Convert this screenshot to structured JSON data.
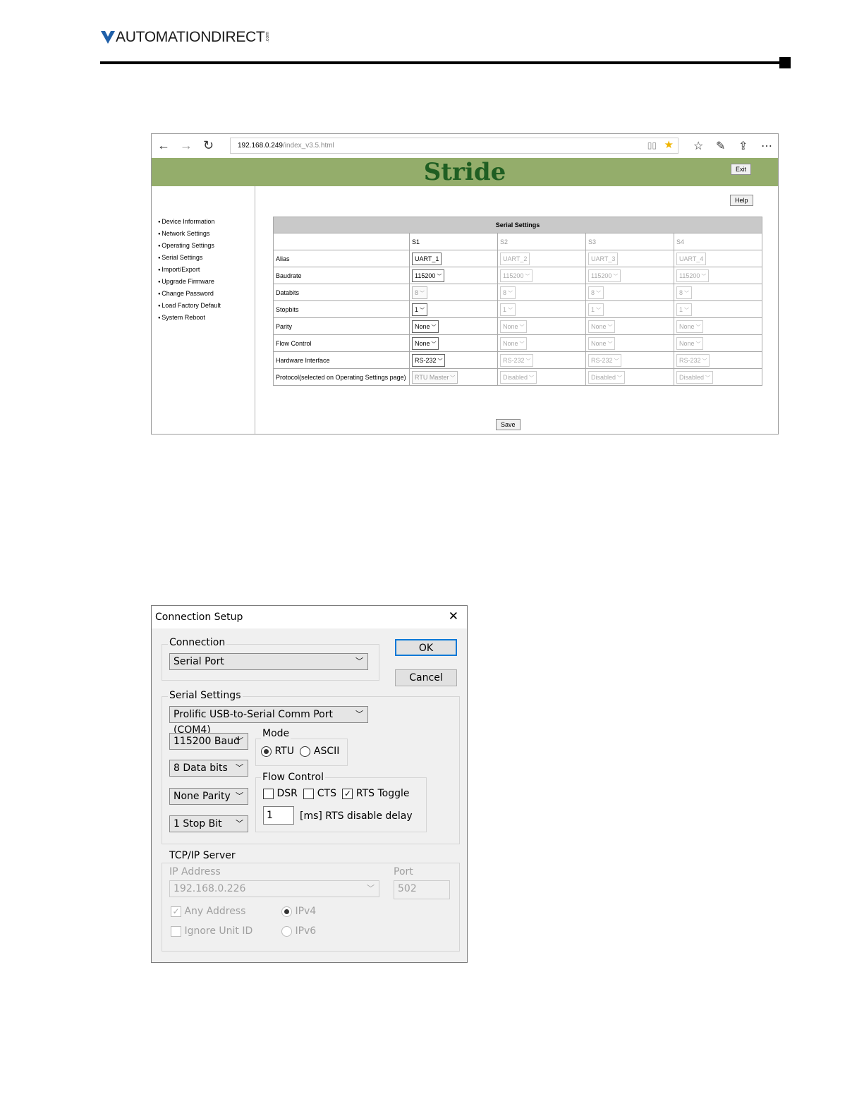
{
  "header": {
    "brand": "AUTOMATIONDIRECT",
    "brand_suffix": ".com"
  },
  "browser": {
    "url_host": "192.168.0.249",
    "url_path": "/index_v3.5.html",
    "app_logo": "Stride",
    "exit_label": "Exit",
    "help_label": "Help",
    "save_label": "Save",
    "sidebar": [
      "Device Information",
      "Network Settings",
      "Operating Settings",
      "Serial Settings",
      "Import/Export",
      "Upgrade Firmware",
      "Change Password",
      "Load Factory Default",
      "System Reboot"
    ],
    "table": {
      "title": "Serial Settings",
      "ports": [
        "S1",
        "S2",
        "S3",
        "S4"
      ],
      "rows": [
        {
          "label": "Alias",
          "values": [
            "UART_1",
            "UART_2",
            "UART_3",
            "UART_4"
          ]
        },
        {
          "label": "Baudrate",
          "values": [
            "115200",
            "115200",
            "115200",
            "115200"
          ]
        },
        {
          "label": "Databits",
          "values": [
            "8",
            "8",
            "8",
            "8"
          ]
        },
        {
          "label": "Stopbits",
          "values": [
            "1",
            "1",
            "1",
            "1"
          ]
        },
        {
          "label": "Parity",
          "values": [
            "None",
            "None",
            "None",
            "None"
          ]
        },
        {
          "label": "Flow Control",
          "values": [
            "None",
            "None",
            "None",
            "None"
          ]
        },
        {
          "label": "Hardware Interface",
          "values": [
            "RS-232",
            "RS-232",
            "RS-232",
            "RS-232"
          ]
        },
        {
          "label": "Protocol(selected on Operating Settings page)",
          "values": [
            "RTU Master",
            "Disabled",
            "Disabled",
            "Disabled"
          ]
        }
      ]
    }
  },
  "dialog": {
    "title": "Connection Setup",
    "close": "✕",
    "ok_label": "OK",
    "cancel_label": "Cancel",
    "connection": {
      "label": "Connection",
      "value": "Serial Port"
    },
    "serial": {
      "label": "Serial Settings",
      "port": "Prolific USB-to-Serial Comm Port (COM4)",
      "baud": "115200 Baud",
      "databits": "8 Data bits",
      "parity": "None Parity",
      "stopbit": "1 Stop Bit",
      "mode_label": "Mode",
      "mode_rtu": "RTU",
      "mode_ascii": "ASCII",
      "flow_label": "Flow Control",
      "dsr": "DSR",
      "cts": "CTS",
      "rts": "RTS Toggle",
      "delay_value": "1",
      "delay_label": "[ms] RTS disable delay"
    },
    "tcp": {
      "label": "TCP/IP Server",
      "ip_label": "IP Address",
      "ip_value": "192.168.0.226",
      "port_label": "Port",
      "port_value": "502",
      "any_address": "Any Address",
      "ignore_unit": "Ignore Unit ID",
      "ipv4": "IPv4",
      "ipv6": "IPv6"
    }
  }
}
